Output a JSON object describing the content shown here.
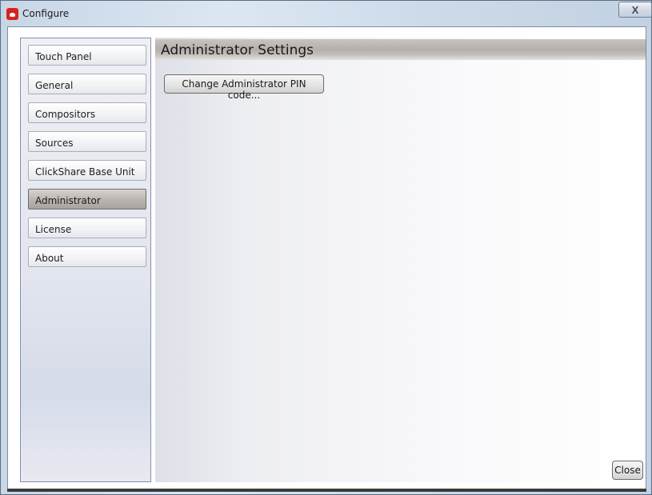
{
  "window": {
    "title": "Configure",
    "close_glyph": "X",
    "icon": "clickshare-app-icon"
  },
  "sidebar": {
    "items": [
      {
        "label": "Touch Panel",
        "active": false
      },
      {
        "label": "General",
        "active": false
      },
      {
        "label": "Compositors",
        "active": false
      },
      {
        "label": "Sources",
        "active": false
      },
      {
        "label": "ClickShare Base Unit",
        "active": false
      },
      {
        "label": "Administrator",
        "active": true
      },
      {
        "label": "License",
        "active": false
      },
      {
        "label": "About",
        "active": false
      }
    ]
  },
  "main": {
    "title": "Administrator Settings",
    "change_pin_label": "Change Administrator PIN code..."
  },
  "footer": {
    "close_label": "Close"
  },
  "colors": {
    "active_item": "#b9b4b0",
    "header_bar": "#b4afab",
    "sidebar_border": "#7f90b0"
  }
}
